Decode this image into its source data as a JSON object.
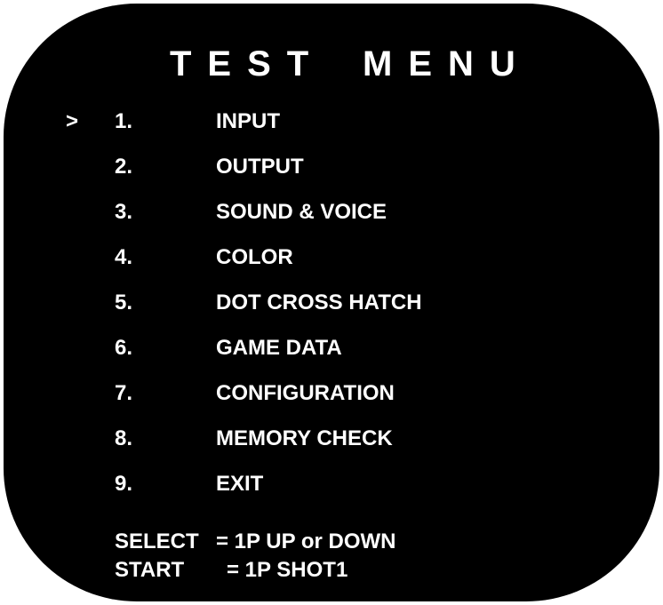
{
  "title": {
    "word1": "TEST",
    "word2": "MENU"
  },
  "cursor": ">",
  "selected_index": 0,
  "menu": [
    {
      "number": "1.",
      "label": "INPUT"
    },
    {
      "number": "2.",
      "label": "OUTPUT"
    },
    {
      "number": "3.",
      "label": "SOUND & VOICE"
    },
    {
      "number": "4.",
      "label": "COLOR"
    },
    {
      "number": "5.",
      "label": "DOT CROSS HATCH"
    },
    {
      "number": "6.",
      "label": "GAME DATA"
    },
    {
      "number": "7.",
      "label": "CONFIGURATION"
    },
    {
      "number": "8.",
      "label": "MEMORY CHECK"
    },
    {
      "number": "9.",
      "label": "EXIT"
    }
  ],
  "instructions": {
    "select_key": "SELECT",
    "select_value": "= 1P UP or DOWN",
    "start_key": "START",
    "start_value": "= 1P SHOT1"
  },
  "colors": {
    "background": "#000000",
    "text": "#ffffff",
    "frame": "#ffffff"
  }
}
